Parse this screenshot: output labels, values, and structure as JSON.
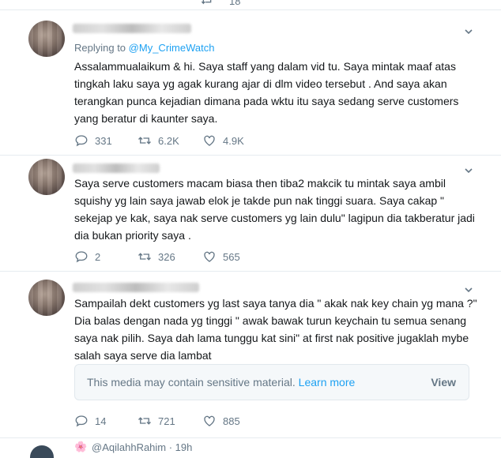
{
  "top": {
    "count": "18"
  },
  "tweets": [
    {
      "replying_prefix": "Replying to",
      "replying_handle": "@My_CrimeWatch",
      "text": "Assalammualaikum & hi. Saya staff yang dalam vid tu. Saya mintak maaf atas tingkah laku saya yg agak kurang ajar di dlm video tersebut . And saya akan terangkan punca kejadian dimana pada wktu itu saya sedang serve customers yang beratur di kaunter saya.",
      "replies": "331",
      "retweets": "6.2K",
      "likes": "4.9K"
    },
    {
      "text": "Saya serve customers macam biasa then tiba2 makcik tu mintak saya ambil squishy yg lain saya jawab elok je takde pun nak tinggi suara. Saya cakap \" sekejap ye kak, saya nak serve customers yg lain dulu\" lagipun dia takberatur jadi dia bukan priority saya .",
      "replies": "2",
      "retweets": "326",
      "likes": "565"
    },
    {
      "text": "Sampailah dekt customers yg last saya tanya dia \" akak nak key chain yg mana ?\" Dia balas dengan nada yg tinggi \" awak bawak turun keychain tu semua senang saya nak pilih. Saya dah lama tunggu kat sini\" at first nak positive jugaklah mybe salah saya serve dia lambat",
      "sensitive": {
        "message": "This media may contain sensitive material.",
        "learn_more": "Learn more",
        "view": "View"
      },
      "replies": "14",
      "retweets": "721",
      "likes": "885"
    }
  ],
  "next_tweet": {
    "handle": "@AqilahhRahim · 19h"
  },
  "icons": {
    "reply": "reply-icon",
    "retweet": "retweet-icon",
    "like": "heart-icon",
    "caret": "chevron-down-icon"
  }
}
